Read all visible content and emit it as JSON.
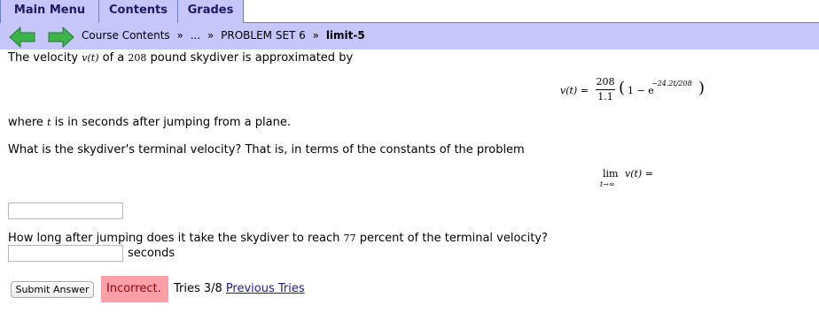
{
  "tabs": [
    "Main Menu",
    "Contents",
    "Grades"
  ],
  "breadcrumb": {
    "course": "Course Contents",
    "sep1": "»",
    "ellipsis": "...",
    "sep2": "»",
    "problem_set": "PROBLEM SET 6",
    "sep3": "»",
    "current": "limit-5"
  },
  "problem": {
    "intro_pre": "The velocity",
    "intro_var": "v(t)",
    "intro_mid": "of a",
    "weight": "208",
    "intro_post": "pound skydiver is approximated by",
    "eq1": {
      "lhs": "v(t) =",
      "numerator": "208",
      "denominator": "1.1",
      "open": "(",
      "inner": "1 − e",
      "exponent": "−24.2t/208",
      "close": ")"
    },
    "where_pre": "where",
    "where_var": "t",
    "where_post": "is in seconds after jumping from a plane.",
    "question1": "What is the skydiver's terminal velocity? That is, in terms of the constants of the problem",
    "eq2": {
      "lim": "lim",
      "sub": "t→∞",
      "rhs": "v(t) ="
    },
    "answer1_value": "",
    "question2_pre": "How long after jumping does it take the skydiver to reach",
    "percent": "77",
    "question2_post": "percent of the terminal velocity?",
    "answer2_value": "",
    "answer2_unit": "seconds"
  },
  "submit_label": "Submit Answer",
  "status_text": "Incorrect.",
  "tries_text": "Tries 3/8",
  "previous_tries_link": "Previous Tries",
  "colors": {
    "tab_bg": "#c6c6fa",
    "nav_bg": "#c6c6fa",
    "arrow_green": "#3cb44a",
    "incorrect_bg": "#ffa0a8"
  }
}
